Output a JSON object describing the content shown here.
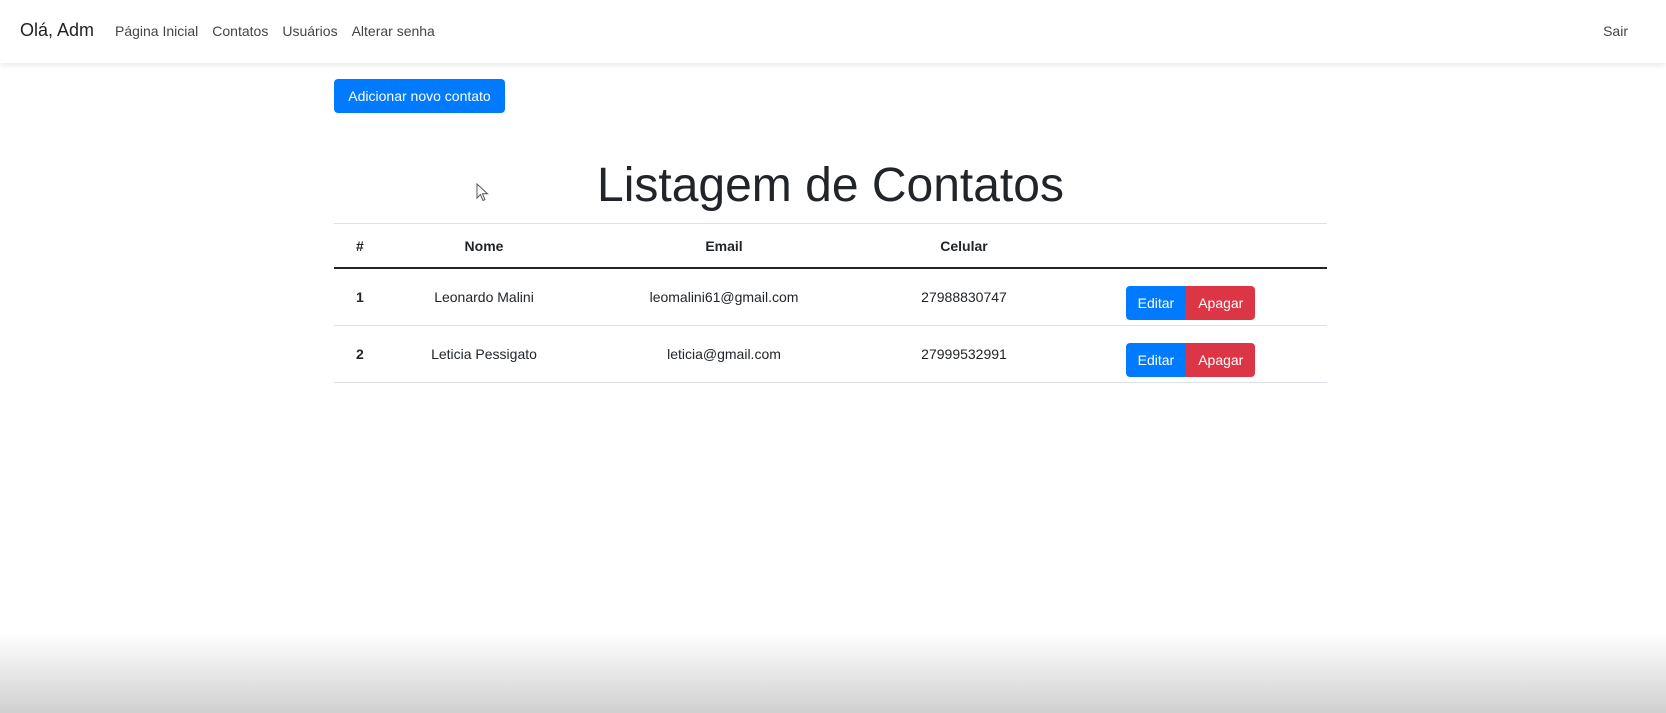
{
  "navbar": {
    "brand": "Olá, Adm",
    "links": [
      {
        "label": "Página Inicial"
      },
      {
        "label": "Contatos"
      },
      {
        "label": "Usuários"
      },
      {
        "label": "Alterar senha"
      }
    ],
    "logout_label": "Sair"
  },
  "main": {
    "add_button_label": "Adicionar novo contato",
    "title": "Listagem de Contatos",
    "table": {
      "headers": [
        "#",
        "Nome",
        "Email",
        "Celular",
        ""
      ],
      "rows": [
        {
          "num": "1",
          "name": "Leonardo Malini",
          "email": "leomalini61@gmail.com",
          "phone": "27988830747",
          "edit_label": "Editar",
          "delete_label": "Apagar"
        },
        {
          "num": "2",
          "name": "Leticia Pessigato",
          "email": "leticia@gmail.com",
          "phone": "27999532991",
          "edit_label": "Editar",
          "delete_label": "Apagar"
        }
      ]
    }
  },
  "colors": {
    "primary": "#007bff",
    "danger": "#dc3545"
  },
  "icons": {
    "cursor": "mouse-pointer-icon"
  }
}
